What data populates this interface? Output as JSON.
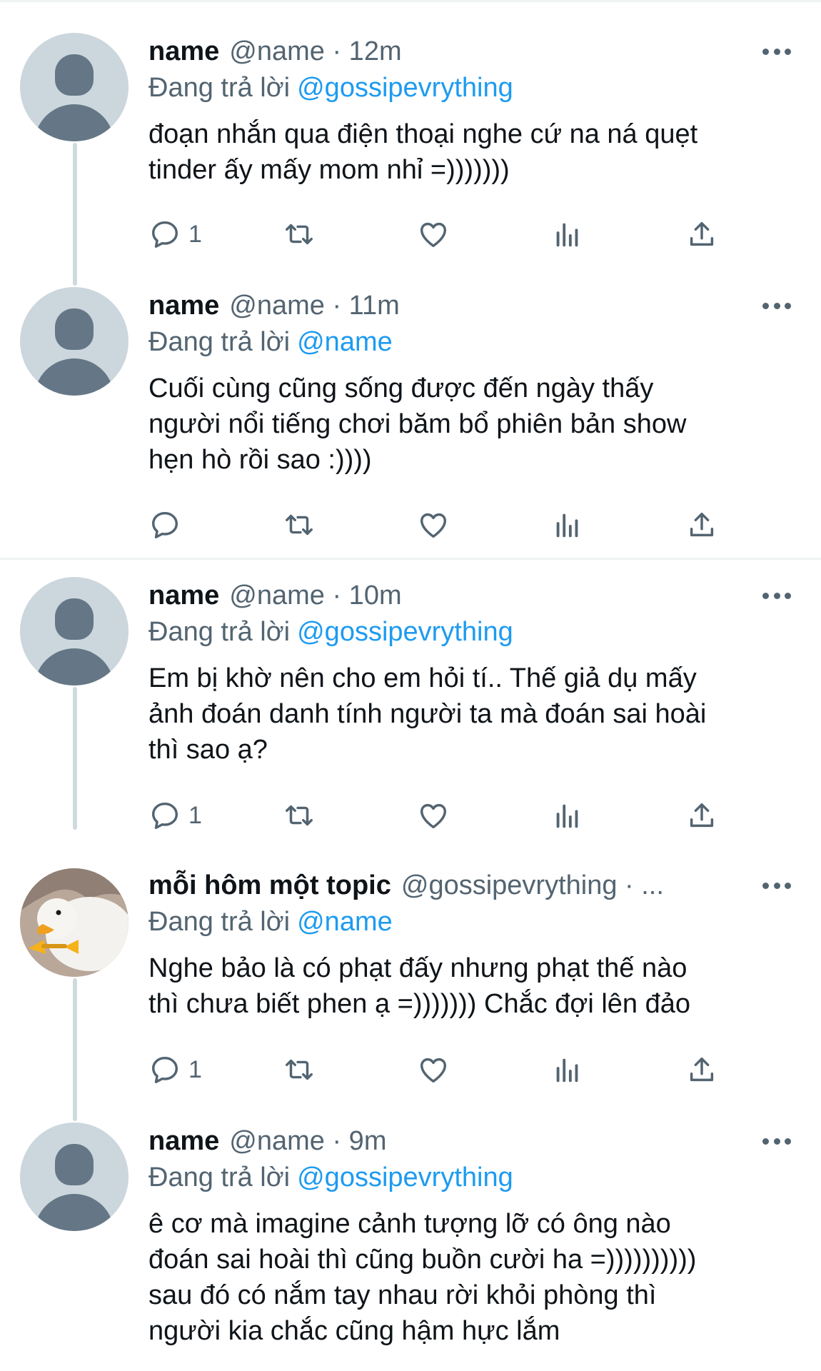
{
  "colors": {
    "accent": "#1d9bf0",
    "secondary_text": "#536471",
    "primary_text": "#0f1419",
    "thread_line": "#cfd9de",
    "separator": "#eff3f4"
  },
  "tweets": [
    {
      "display_name": "name",
      "handle_time": "@name · 12m",
      "reply_prefix": "Đang trả lời",
      "reply_to": "@gossipevrything",
      "text_lines": [
        "đoạn nhắn qua điện thoại nghe cứ na ná quẹt",
        "tinder ấy mấy mom nhỉ =)))))))"
      ],
      "reply_count": "1",
      "avatar_icon": "default-profile-icon"
    },
    {
      "display_name": "name",
      "handle_time": "@name · 11m",
      "reply_prefix": "Đang trả lời",
      "reply_to": "@name",
      "text_lines": [
        "Cuối cùng cũng sống được đến ngày thấy",
        "người nổi tiếng chơi băm bổ phiên bản show",
        "hẹn hò rồi sao :))))"
      ],
      "reply_count": "",
      "avatar_icon": "default-profile-icon"
    },
    {
      "display_name": "name",
      "handle_time": "@name · 10m",
      "reply_prefix": "Đang trả lời",
      "reply_to": "@gossipevrything",
      "text_lines": [
        "Em bị khờ nên cho em hỏi tí.. Thế giả dụ mấy",
        "ảnh đoán danh tính người ta mà đoán sai hoài",
        "thì sao ạ?"
      ],
      "reply_count": "1",
      "avatar_icon": "default-profile-icon"
    },
    {
      "display_name": "mỗi hôm một topic",
      "handle_time": "@gossipevrything · ...",
      "reply_prefix": "Đang trả lời",
      "reply_to": "@name",
      "text_lines": [
        "Nghe bảo là có phạt đấy nhưng phạt thế nào",
        "thì chưa biết phen ạ =))))))) Chắc đợi lên đảo"
      ],
      "reply_count": "1",
      "avatar_icon": "goose-avatar"
    },
    {
      "display_name": "name",
      "handle_time": "@name · 9m",
      "reply_prefix": "Đang trả lời",
      "reply_to": "@gossipevrything",
      "text_lines": [
        "ê cơ mà imagine cảnh tượng lỡ có ông nào",
        "đoán sai hoài thì cũng buồn cười ha =))))))))))",
        "sau đó có nắm tay nhau rời khỏi phòng thì",
        "người kia chắc cũng hậm hực lắm"
      ],
      "reply_count": "",
      "avatar_icon": "default-profile-icon"
    }
  ],
  "action_icons": [
    "reply-icon",
    "retweet-icon",
    "like-icon",
    "analytics-icon",
    "share-icon"
  ]
}
